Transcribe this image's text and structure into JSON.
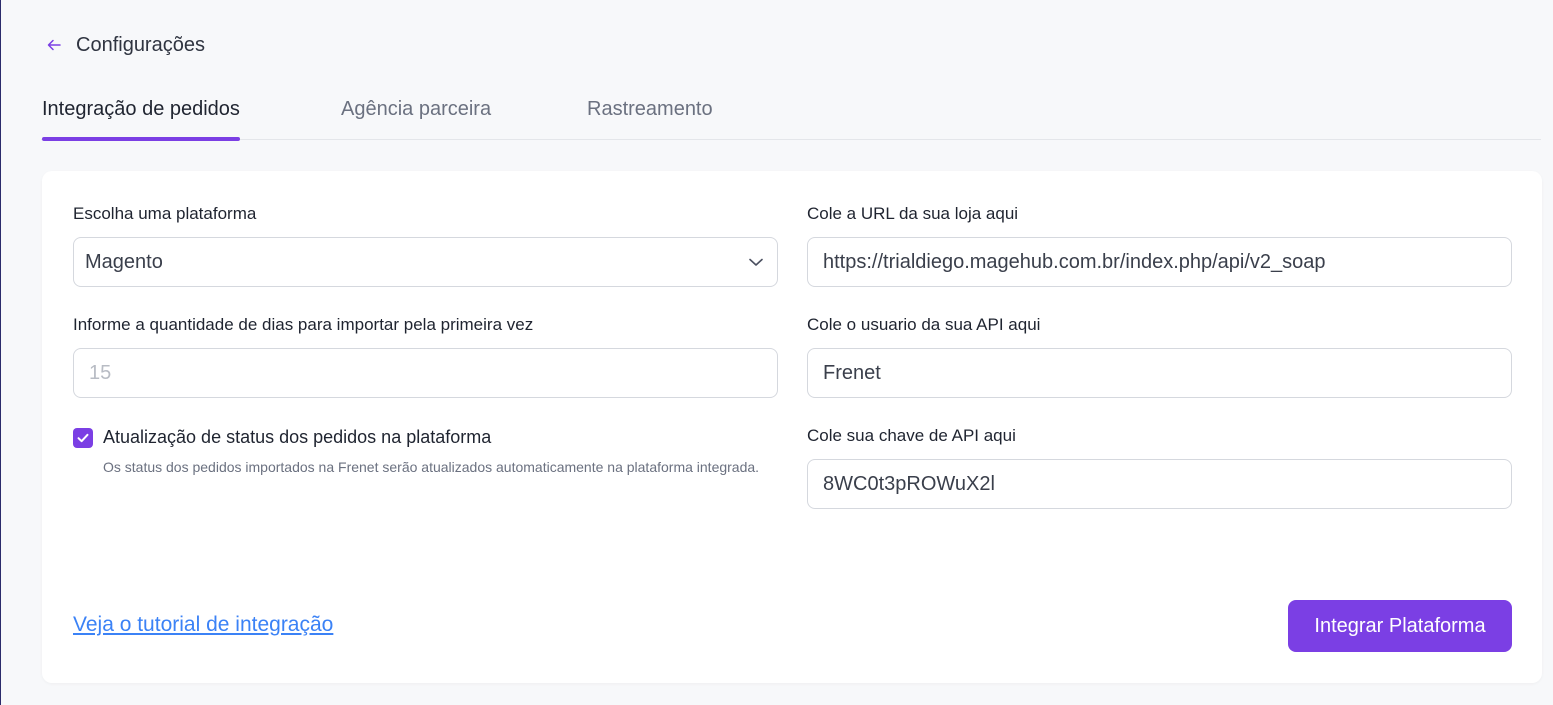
{
  "header": {
    "title": "Configurações",
    "back_icon": "arrow-left-icon"
  },
  "tabs": [
    {
      "label": "Integração de pedidos",
      "active": true
    },
    {
      "label": "Agência parceira",
      "active": false
    },
    {
      "label": "Rastreamento",
      "active": false
    }
  ],
  "form": {
    "platform": {
      "label": "Escolha uma plataforma",
      "value": "Magento",
      "icon": "chevron-down-icon"
    },
    "days": {
      "label": "Informe a quantidade de dias para importar pela primeira vez",
      "value": "",
      "placeholder": "15"
    },
    "status_update": {
      "label": "Atualização de status dos pedidos na plataforma",
      "help": "Os status dos pedidos importados na Frenet serão atualizados automaticamente na plataforma integrada.",
      "checked": true
    },
    "store_url": {
      "label": "Cole a URL da sua loja aqui",
      "value": "https://trialdiego.magehub.com.br/index.php/api/v2_soap"
    },
    "api_user": {
      "label": "Cole o usuario da sua API aqui",
      "value": "Frenet"
    },
    "api_key": {
      "label": "Cole sua chave de API aqui",
      "value": "8WC0t3pROWuX2l"
    }
  },
  "footer": {
    "tutorial_link": "Veja o tutorial de integração",
    "submit_label": "Integrar Plataforma"
  },
  "colors": {
    "accent": "#7b3fe4",
    "link": "#3b82f6"
  }
}
